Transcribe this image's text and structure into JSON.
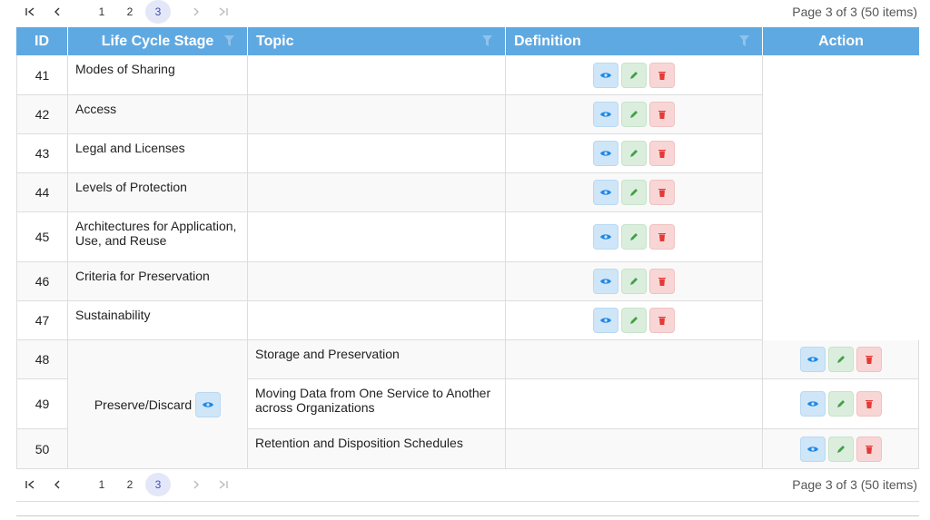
{
  "pager": {
    "pages": [
      "1",
      "2",
      "3"
    ],
    "active_page": "3",
    "info": "Page 3 of 3 (50 items)"
  },
  "columns": {
    "id": "ID",
    "lcs": "Life Cycle Stage",
    "topic": "Topic",
    "definition": "Definition",
    "action": "Action"
  },
  "rows": [
    {
      "id": "41",
      "stage": "Modes of Sharing"
    },
    {
      "id": "42",
      "stage": "Access"
    },
    {
      "id": "43",
      "stage": "Legal and Licenses"
    },
    {
      "id": "44",
      "stage": "Levels of Protection"
    },
    {
      "id": "45",
      "stage": "Architectures for Application, Use, and Reuse"
    },
    {
      "id": "46",
      "stage": "Criteria for Preservation"
    },
    {
      "id": "47",
      "stage": "Sustainability"
    },
    {
      "id": "48",
      "topic": "Storage and Preservation"
    },
    {
      "id": "49",
      "topic": "Moving Data from One Service to Another across Organizations"
    },
    {
      "id": "50",
      "topic": "Retention and Disposition Schedules"
    }
  ],
  "group": {
    "label": "Preserve/Discard"
  },
  "icons": {
    "view": "eye-icon",
    "edit": "pencil-icon",
    "delete": "trash-icon",
    "filter": "filter-icon",
    "first": "first-page-icon",
    "prev": "prev-page-icon",
    "next": "next-page-icon",
    "last": "last-page-icon"
  },
  "colors": {
    "header_bg": "#5fa9e2",
    "view": "#1e88e5",
    "edit": "#43a047",
    "delete": "#e53935",
    "active_page": "#3f51b5"
  }
}
